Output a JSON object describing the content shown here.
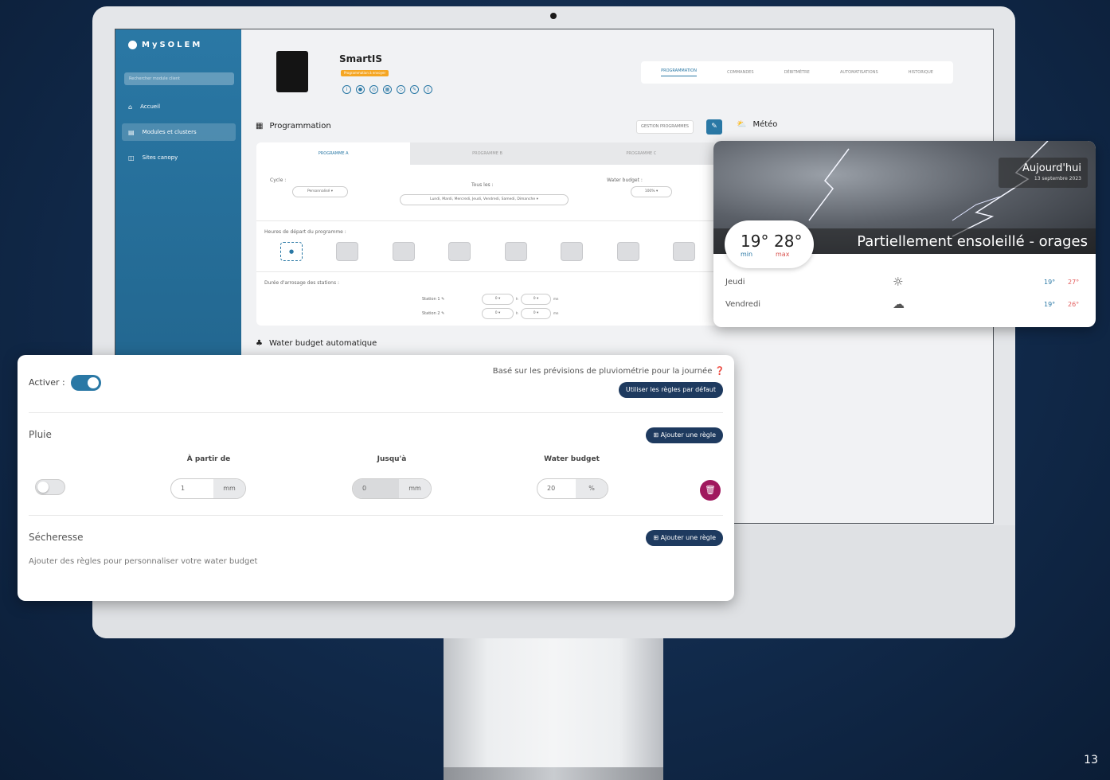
{
  "app": {
    "logo": "MySOLEM",
    "search_placeholder": "Rechercher module client"
  },
  "sidebar": {
    "items": [
      {
        "label": "Accueil",
        "icon": "home-icon"
      },
      {
        "label": "Modules et clusters",
        "icon": "modules-icon"
      },
      {
        "label": "Sites canopy",
        "icon": "map-icon"
      }
    ]
  },
  "device": {
    "name": "SmartIS",
    "badge": "Programmation à envoyer"
  },
  "tabs": [
    "PROGRAMMATION",
    "COMMANDES",
    "DÉBITMÈTRE",
    "AUTOMATISATIONS",
    "HISTORIQUE"
  ],
  "programmation": {
    "title": "Programmation",
    "gestion": "GESTION PROGRAMMES",
    "prog_tabs": [
      "PROGRAMME A",
      "PROGRAMME B",
      "PROGRAMME C"
    ],
    "cycle_label": "Cycle :",
    "cycle_value": "Personnalisé",
    "tous_label": "Tous les :",
    "tous_value": "Lundi, Mardi, Mercredi, Jeudi, Vendredi, Samedi, Dimanche",
    "wb_label": "Water budget :",
    "wb_value": "100%",
    "heures_label": "Heures de départ du programme :",
    "duree_label": "Durée d'arrosage des stations :",
    "stations": [
      {
        "name": "Station 1",
        "h": "0",
        "m": "0"
      },
      {
        "name": "Station 2",
        "h": "0",
        "m": "0"
      }
    ],
    "unit_h": "h",
    "unit_m": "mn"
  },
  "water_budget_title": "Water budget automatique",
  "meteo": {
    "title": "Météo",
    "today": "Aujourd'hui",
    "date": "13 septembre 2023",
    "min": "19°",
    "min_label": "min",
    "max": "28°",
    "max_label": "max",
    "condition": "Partiellement ensoleillé - orages",
    "forecast": [
      {
        "day": "Jeudi",
        "icon": "sun-icon",
        "min": "19°",
        "max": "27°"
      },
      {
        "day": "Vendredi",
        "icon": "partly-cloudy-icon",
        "min": "19°",
        "max": "26°"
      }
    ]
  },
  "wb_card": {
    "activer": "Activer :",
    "base": "Basé sur les prévisions de pluviométrie pour la journée",
    "default_btn": "Utiliser les règles par défaut",
    "pluie": "Pluie",
    "add_rule": "Ajouter une règle",
    "col_from": "À partir de",
    "col_to": "Jusqu'à",
    "col_wb": "Water budget",
    "from_value": "1",
    "from_unit": "mm",
    "to_value": "0",
    "to_unit": "mm",
    "wb_value": "20",
    "wb_unit": "%",
    "secheresse": "Sécheresse",
    "add_rule2": "Ajouter une règle",
    "hint": "Ajouter des règles pour personnaliser votre water budget"
  },
  "page_number": "13"
}
